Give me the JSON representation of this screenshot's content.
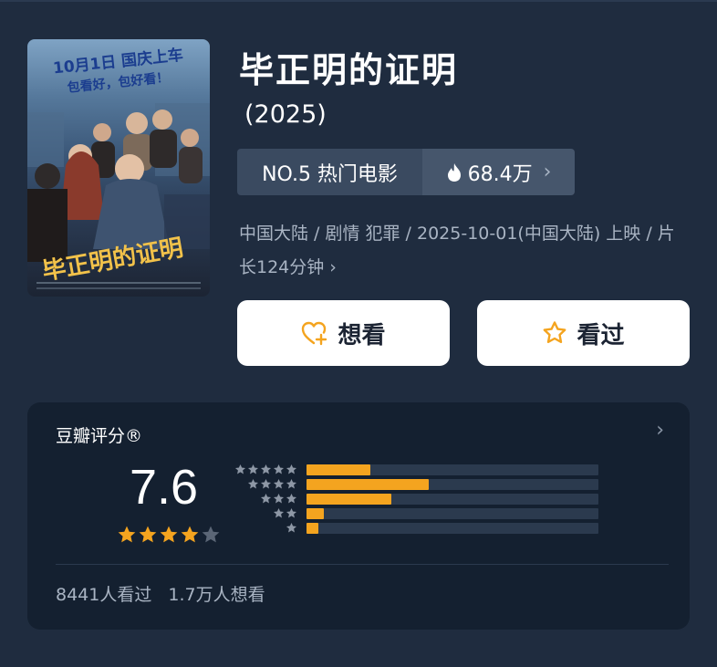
{
  "poster": {
    "tagline_top": "10月1日 国庆上车",
    "tagline_sub": "包看好，包好看！",
    "poster_title": "毕正明的证明"
  },
  "movie": {
    "title": "毕正明的证明",
    "year": "(2025)"
  },
  "rank": {
    "label": "NO.5 热门电影",
    "heat": "68.4万"
  },
  "meta": {
    "text": "中国大陆 / 剧情 犯罪 / 2025-10-01(中国大陆) 上映 / 片长124分钟"
  },
  "actions": {
    "want_label": "想看",
    "seen_label": "看过"
  },
  "rating": {
    "title": "豆瓣评分®",
    "score": "7.6",
    "stars": 4,
    "distribution": [
      {
        "stars": 5,
        "fraction": 0.22
      },
      {
        "stars": 4,
        "fraction": 0.42
      },
      {
        "stars": 3,
        "fraction": 0.29
      },
      {
        "stars": 2,
        "fraction": 0.06
      },
      {
        "stars": 1,
        "fraction": 0.04
      }
    ],
    "watched": "8441人看过",
    "wanted": "1.7万人想看"
  },
  "colors": {
    "background": "#1f2c3f",
    "card": "#142030",
    "star": "#f4a41f",
    "accent_icon": "#f4a41f"
  }
}
